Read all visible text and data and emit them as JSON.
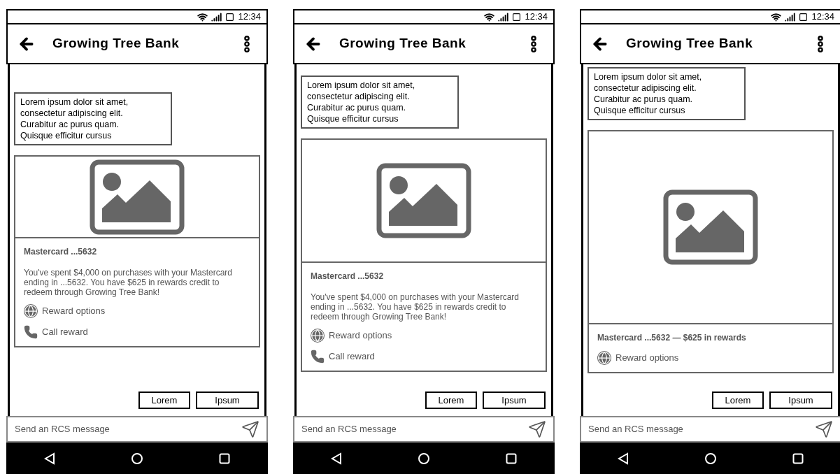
{
  "phones": [
    {
      "status_time": "12:34",
      "title": "Growing Tree Bank",
      "message": [
        "Lorem ipsum dolor sit amet,",
        "consectetur adipiscing elit.",
        "Curabitur ac purus quam.",
        "Quisque efficitur cursus"
      ],
      "card": {
        "kind": "short",
        "title": "Mastercard ...5632",
        "body": "You've spent $4,000 on purchases with your Mastercard ending in ...5632. You have $625 in rewards credit to redeem through Growing Tree Bank!",
        "actions": [
          {
            "kind": "web",
            "label": "Reward options"
          },
          {
            "kind": "call",
            "label": "Call reward"
          }
        ]
      },
      "chips": [
        "Lorem",
        "Ipsum"
      ],
      "composer": {
        "placeholder": "Send an RCS message"
      }
    },
    {
      "status_time": "12:34",
      "title": "Growing Tree Bank",
      "message": [
        "Lorem ipsum dolor sit amet,",
        "consectetur adipiscing elit.",
        "Curabitur ac purus quam.",
        "Quisque efficitur cursus"
      ],
      "card": {
        "kind": "medium",
        "title": "Mastercard ...5632",
        "body": "You've spent $4,000 on purchases with your Mastercard ending in ...5632. You have $625 in rewards credit to redeem through Growing Tree Bank!",
        "actions": [
          {
            "kind": "web",
            "label": "Reward options"
          },
          {
            "kind": "call",
            "label": "Call reward"
          }
        ]
      },
      "chips": [
        "Lorem",
        "Ipsum"
      ],
      "composer": {
        "placeholder": "Send an RCS message"
      }
    },
    {
      "status_time": "12:34",
      "title": "Growing Tree Bank",
      "message": [
        "Lorem ipsum dolor sit amet,",
        "consectetur adipiscing elit.",
        "Curabitur ac purus quam.",
        "Quisque efficitur cursus"
      ],
      "card": {
        "kind": "tall",
        "title": "Mastercard ...5632 — $625 in rewards",
        "actions": [
          {
            "kind": "web",
            "label": "Reward options"
          }
        ]
      },
      "chips": [
        "Lorem",
        "Ipsum"
      ],
      "composer": {
        "placeholder": "Send an RCS message"
      }
    }
  ]
}
